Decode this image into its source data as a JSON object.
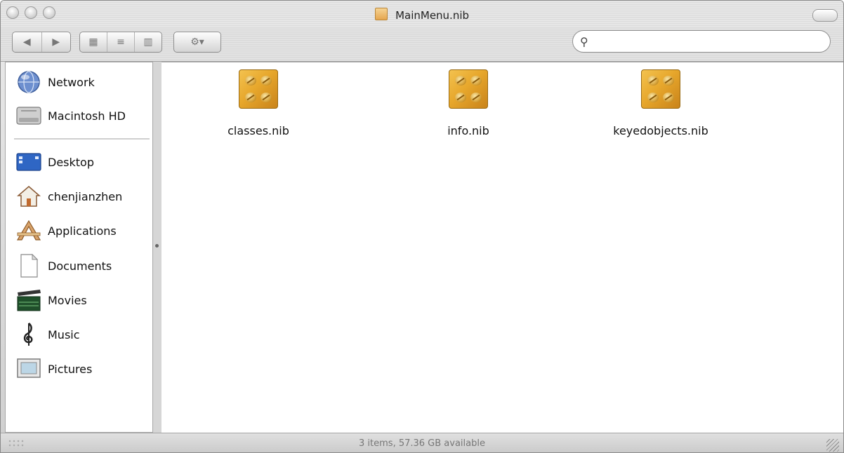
{
  "window": {
    "title": "MainMenu.nib"
  },
  "toolbar": {
    "back_glyph": "◀",
    "forward_glyph": "▶",
    "view_icon_glyph": "▦",
    "view_list_glyph": "≡",
    "view_column_glyph": "▥",
    "action_glyph": "⚙▾",
    "search_glyph": "⚲"
  },
  "search": {
    "value": "",
    "placeholder": ""
  },
  "sidebar": {
    "devices": [
      {
        "label": "Network",
        "icon": "network-globe-icon"
      },
      {
        "label": "Macintosh HD",
        "icon": "hard-drive-icon"
      }
    ],
    "places": [
      {
        "label": "Desktop",
        "icon": "desktop-icon"
      },
      {
        "label": "chenjianzhen",
        "icon": "home-icon"
      },
      {
        "label": "Applications",
        "icon": "applications-icon"
      },
      {
        "label": "Documents",
        "icon": "documents-icon"
      },
      {
        "label": "Movies",
        "icon": "movies-icon"
      },
      {
        "label": "Music",
        "icon": "music-icon"
      },
      {
        "label": "Pictures",
        "icon": "pictures-icon"
      }
    ]
  },
  "files": [
    {
      "name": "classes.nib",
      "icon": "nib-file-icon"
    },
    {
      "name": "info.nib",
      "icon": "nib-file-icon"
    },
    {
      "name": "keyedobjects.nib",
      "icon": "nib-file-icon"
    }
  ],
  "status": {
    "text": "3 items, 57.36 GB available"
  },
  "colors": {
    "nib_gold": "#e7a72c",
    "chrome_gray": "#d9d9d9",
    "status_text": "#777777"
  }
}
